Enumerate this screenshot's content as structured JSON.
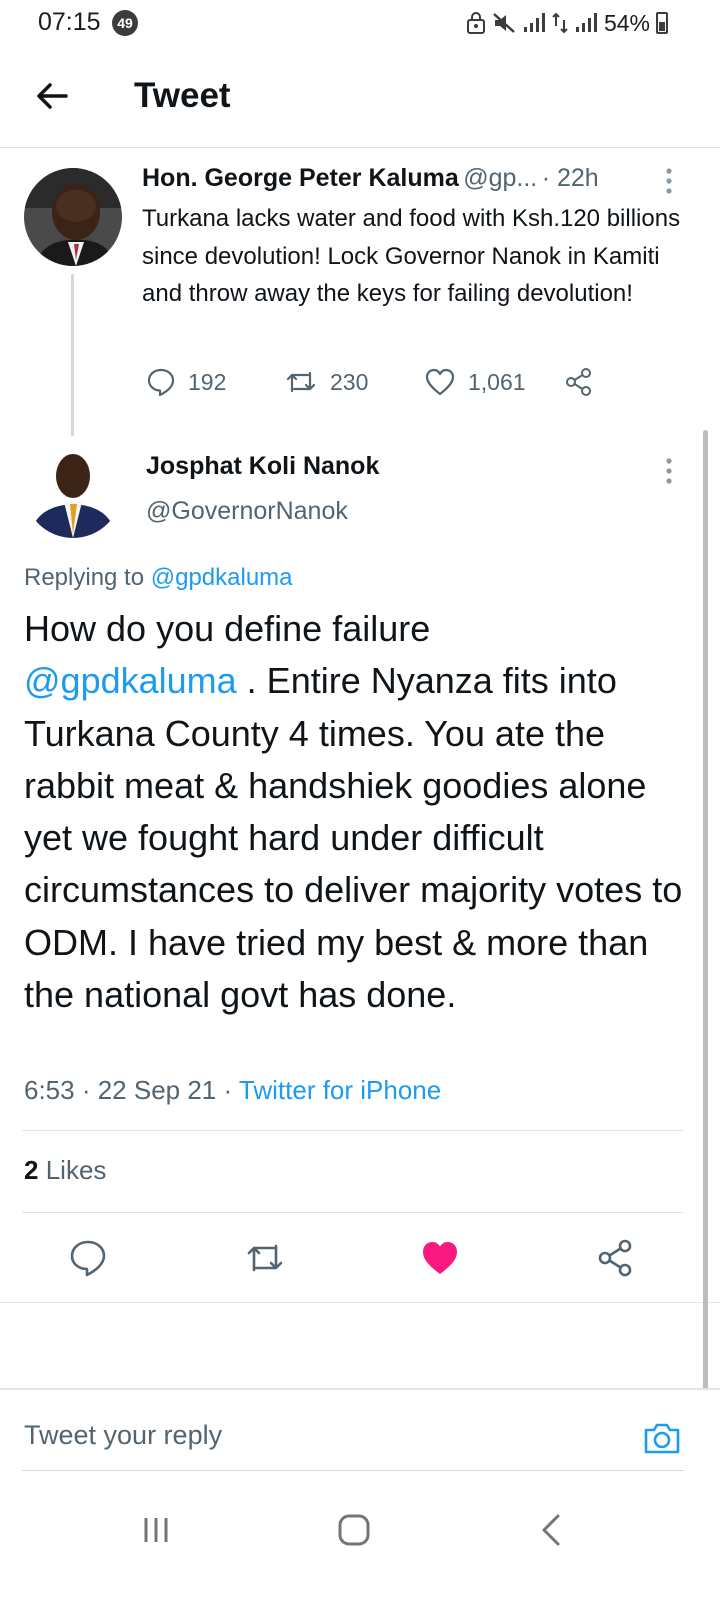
{
  "status_bar": {
    "time": "07:15",
    "notification_count": "49",
    "battery": "54%"
  },
  "header": {
    "title": "Tweet"
  },
  "parent_tweet": {
    "display_name": "Hon. George Peter Kaluma",
    "handle": "@gp...",
    "time": "· 22h",
    "text": "Turkana lacks water and food with Ksh.120 billions since devolution! Lock Governor Nanok in Kamiti and throw away the keys for failing devolution!",
    "replies": "192",
    "retweets": "230",
    "likes": "1,061"
  },
  "main_tweet": {
    "display_name": "Josphat Koli Nanok",
    "handle": "@GovernorNanok",
    "replying_prefix": "Replying to",
    "replying_to": "@gpdkaluma",
    "text_line1": "How do you define failure",
    "mention": "@gpdkaluma",
    "text_rest": " . Entire Nyanza fits into Turkana County 4 times. You ate the rabbit meat & handshiek goodies alone yet we fought hard under difficult circumstances to deliver majority votes to ODM. I have tried my best & more than the national govt has done.",
    "timestamp": "6:53 · 22 Sep 21 · ",
    "source": "Twitter for iPhone",
    "like_count": "2",
    "like_label": "Likes",
    "liked": true
  },
  "reply_box": {
    "placeholder": "Tweet your reply"
  },
  "colors": {
    "accent": "#1d9bf0",
    "like": "#f91880",
    "secondary_text": "#536471"
  }
}
